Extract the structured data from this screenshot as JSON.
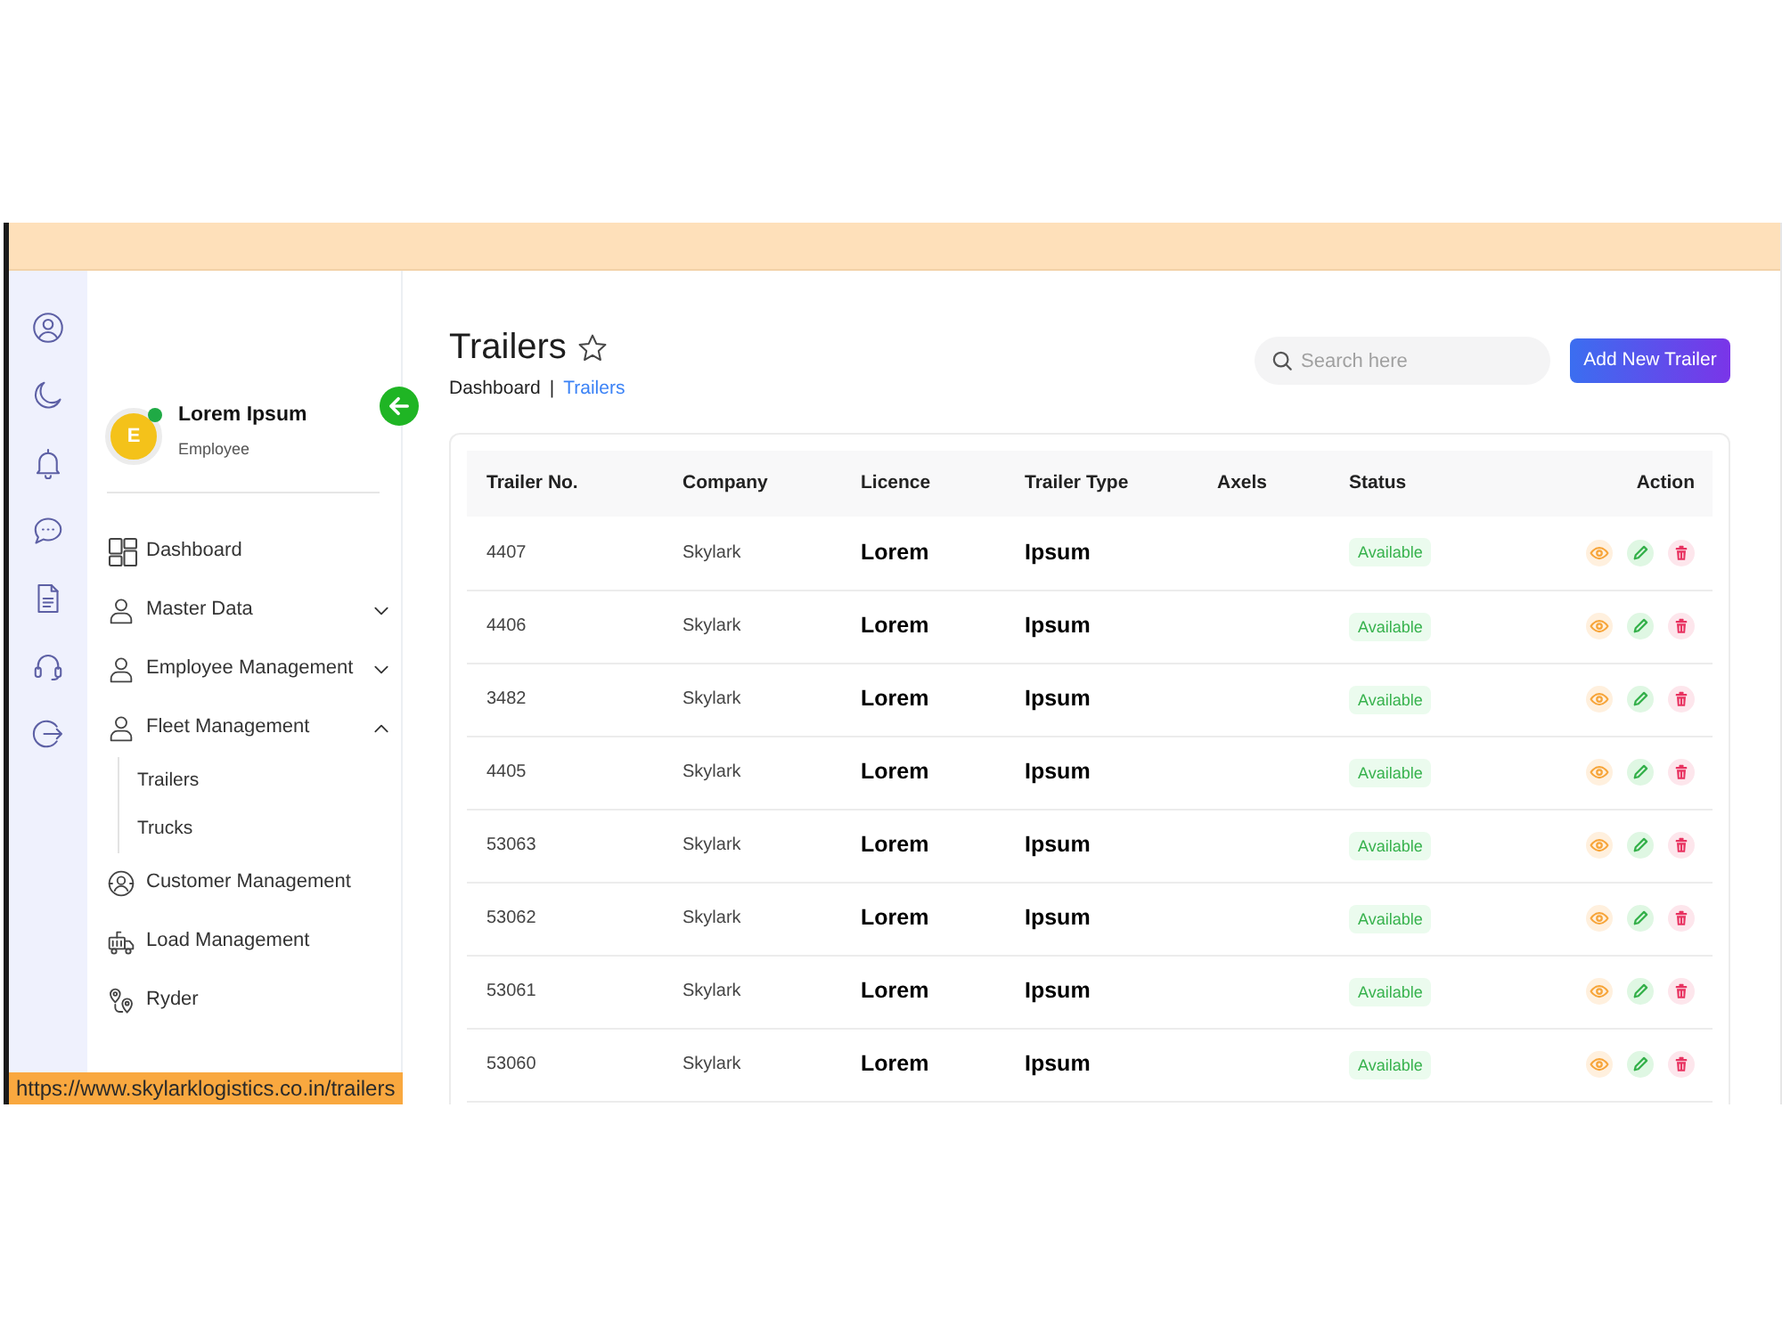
{
  "profile": {
    "initial": "E",
    "name": "Lorem Ipsum",
    "role": "Employee",
    "online": true
  },
  "sidebar": {
    "items": [
      {
        "label": "Dashboard"
      },
      {
        "label": "Master Data",
        "expanded": false
      },
      {
        "label": "Employee Management",
        "expanded": false
      },
      {
        "label": "Fleet Management",
        "expanded": true,
        "children": [
          {
            "label": "Trailers"
          },
          {
            "label": "Trucks"
          }
        ]
      },
      {
        "label": "Customer Management"
      },
      {
        "label": "Load Management"
      },
      {
        "label": "Ryder"
      }
    ]
  },
  "page": {
    "title": "Trailers",
    "starred": false,
    "breadcrumb": {
      "separator": "|",
      "items": [
        {
          "label": "Dashboard",
          "current": false
        },
        {
          "label": "Trailers",
          "current": true
        }
      ]
    },
    "search": {
      "placeholder": "Search here"
    },
    "add_button": "Add New Trailer"
  },
  "table": {
    "columns": [
      "Trailer No.",
      "Company",
      "Licence",
      "Trailer Type",
      "Axels",
      "Status",
      "Action"
    ],
    "rows": [
      {
        "trailer_no": "4407",
        "company": "Skylark",
        "licence": "Lorem",
        "trailer_type": "Ipsum",
        "status": "Available"
      },
      {
        "trailer_no": "4406",
        "company": "Skylark",
        "licence": "Lorem",
        "trailer_type": "Ipsum",
        "status": "Available"
      },
      {
        "trailer_no": "3482",
        "company": "Skylark",
        "licence": "Lorem",
        "trailer_type": "Ipsum",
        "status": "Available"
      },
      {
        "trailer_no": "4405",
        "company": "Skylark",
        "licence": "Lorem",
        "trailer_type": "Ipsum",
        "status": "Available"
      },
      {
        "trailer_no": "53063",
        "company": "Skylark",
        "licence": "Lorem",
        "trailer_type": "Ipsum",
        "status": "Available"
      },
      {
        "trailer_no": "53062",
        "company": "Skylark",
        "licence": "Lorem",
        "trailer_type": "Ipsum",
        "status": "Available"
      },
      {
        "trailer_no": "53061",
        "company": "Skylark",
        "licence": "Lorem",
        "trailer_type": "Ipsum",
        "status": "Available"
      },
      {
        "trailer_no": "53060",
        "company": "Skylark",
        "licence": "Lorem",
        "trailer_type": "Ipsum",
        "status": "Available"
      }
    ]
  },
  "status_bar": {
    "url": "https://www.skylarklogistics.co.in/trailers"
  }
}
